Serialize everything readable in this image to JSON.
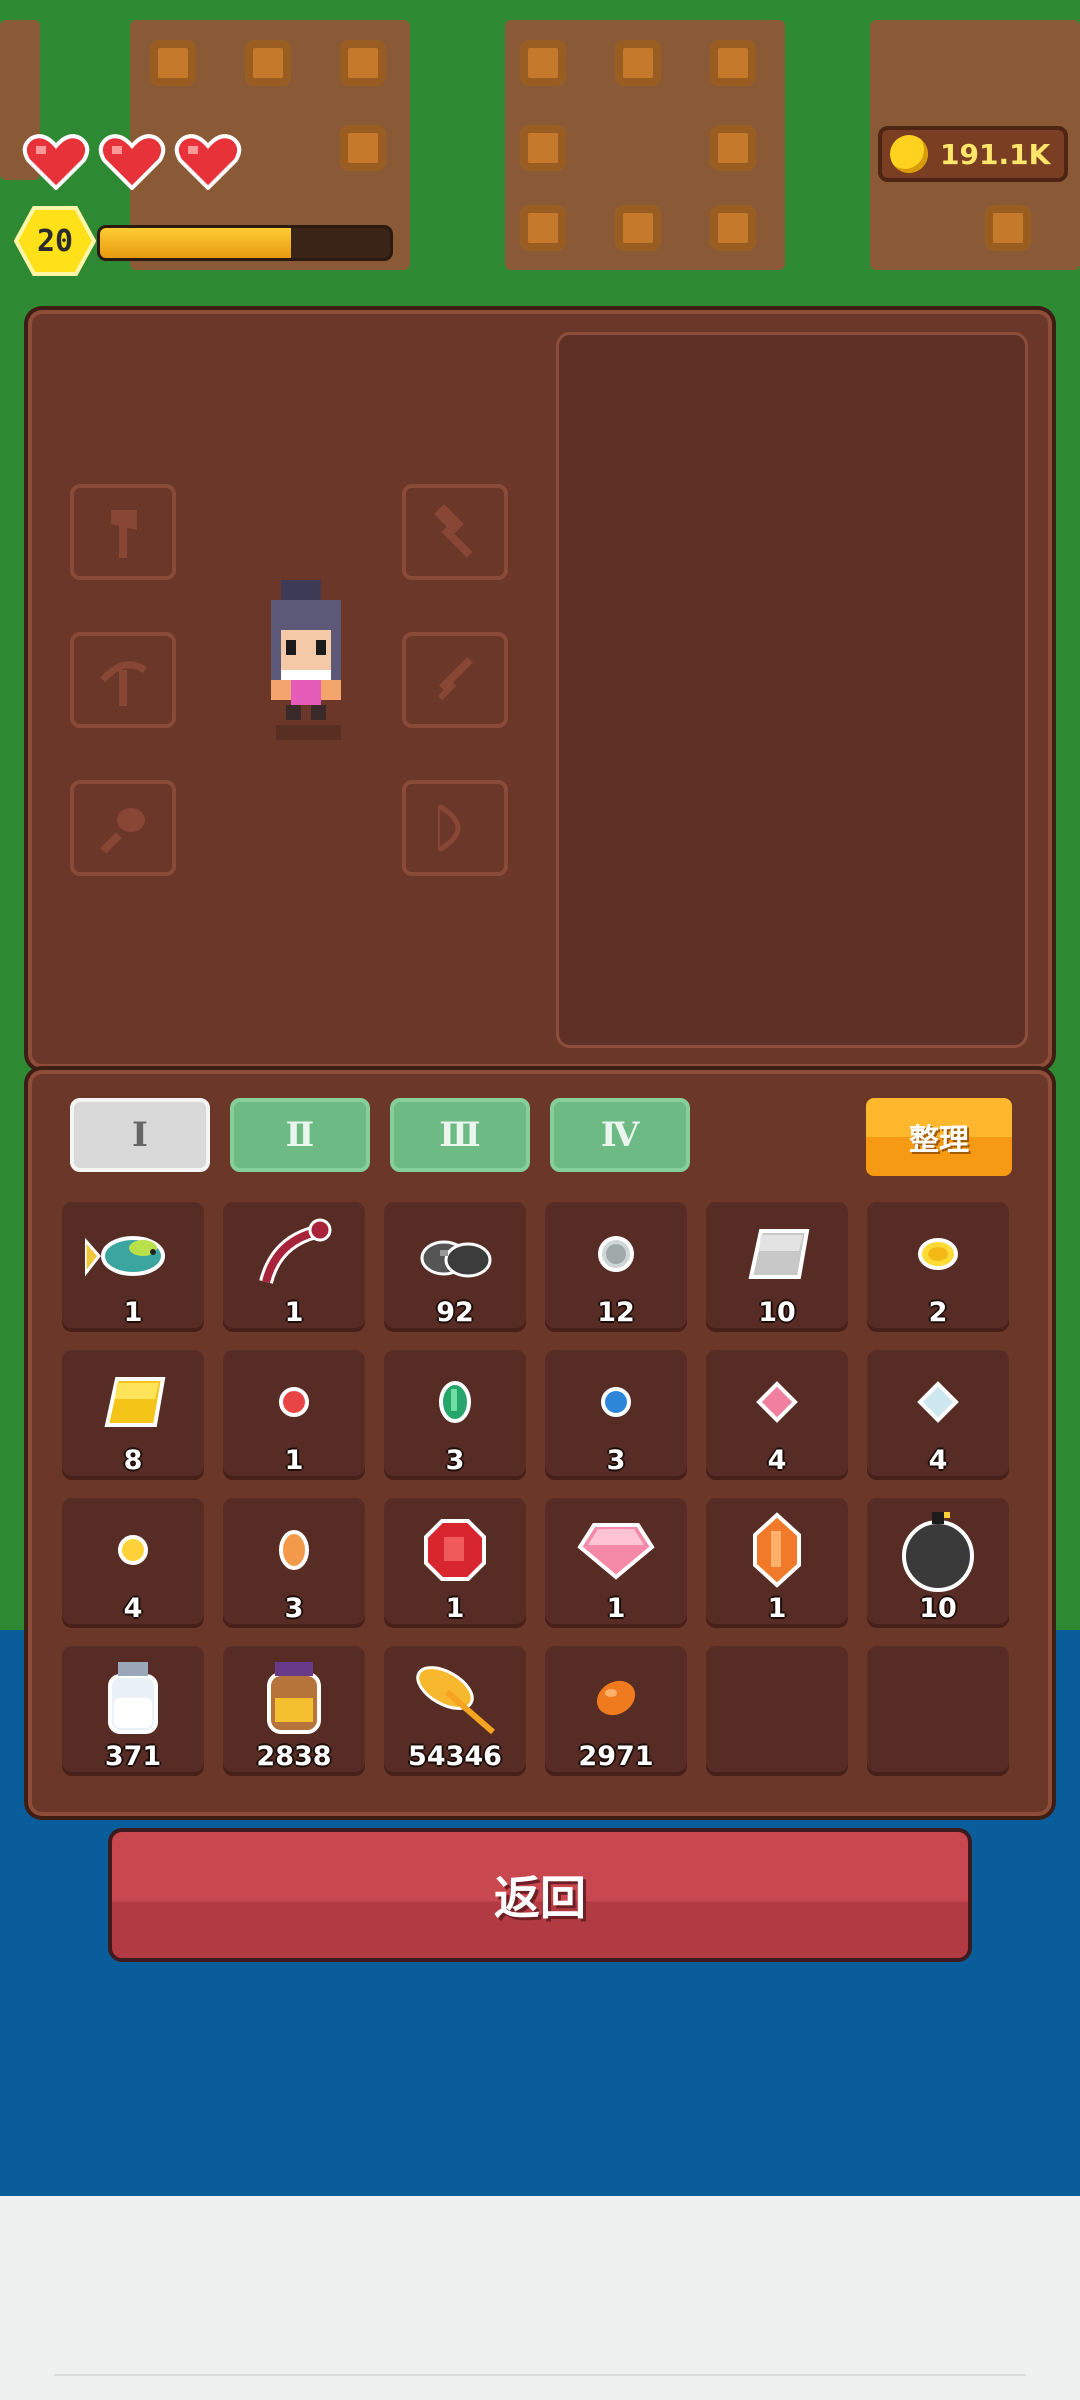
{
  "hud": {
    "hearts": 3,
    "level": "20",
    "xp_progress": 0.66,
    "coins": "191.1K"
  },
  "colors": {
    "accent": "#ffb72e",
    "panel": "#6b3729",
    "tab_active": "#d9d9d9",
    "tab_inactive": "#6dba85",
    "back_button": "#c9474f"
  },
  "equipment": {
    "left_slots": [
      "axe-icon",
      "pickaxe-icon",
      "shovel-icon"
    ],
    "right_slots": [
      "hammer-icon",
      "sword-icon",
      "bow-icon"
    ]
  },
  "tabs": [
    {
      "label": "Ⅰ",
      "active": true
    },
    {
      "label": "Ⅱ",
      "active": false
    },
    {
      "label": "Ⅲ",
      "active": false
    },
    {
      "label": "Ⅳ",
      "active": false
    }
  ],
  "sort_button": "整理",
  "inventory": [
    {
      "icon": "fish-icon",
      "count": "1"
    },
    {
      "icon": "lobster-icon",
      "count": "1"
    },
    {
      "icon": "coal-ore-icon",
      "count": "92"
    },
    {
      "icon": "silver-nugget-icon",
      "count": "12"
    },
    {
      "icon": "iron-bar-icon",
      "count": "10"
    },
    {
      "icon": "gold-nugget-icon",
      "count": "2"
    },
    {
      "icon": "gold-bar-icon",
      "count": "8"
    },
    {
      "icon": "ruby-shard-icon",
      "count": "1"
    },
    {
      "icon": "emerald-shard-icon",
      "count": "3"
    },
    {
      "icon": "sapphire-shard-icon",
      "count": "3"
    },
    {
      "icon": "pink-shard-icon",
      "count": "4"
    },
    {
      "icon": "diamond-shard-icon",
      "count": "4"
    },
    {
      "icon": "gold-gem-icon",
      "count": "4"
    },
    {
      "icon": "amber-gem-icon",
      "count": "3"
    },
    {
      "icon": "ruby-icon",
      "count": "1"
    },
    {
      "icon": "pink-diamond-icon",
      "count": "1"
    },
    {
      "icon": "topaz-icon",
      "count": "1"
    },
    {
      "icon": "bomb-icon",
      "count": "10"
    },
    {
      "icon": "milk-jar-icon",
      "count": "371"
    },
    {
      "icon": "honey-jar-icon",
      "count": "2838"
    },
    {
      "icon": "feather-icon",
      "count": "54346"
    },
    {
      "icon": "seed-icon",
      "count": "2971"
    },
    {
      "icon": "empty-slot",
      "count": ""
    },
    {
      "icon": "empty-slot",
      "count": ""
    }
  ],
  "back_button": "返回"
}
